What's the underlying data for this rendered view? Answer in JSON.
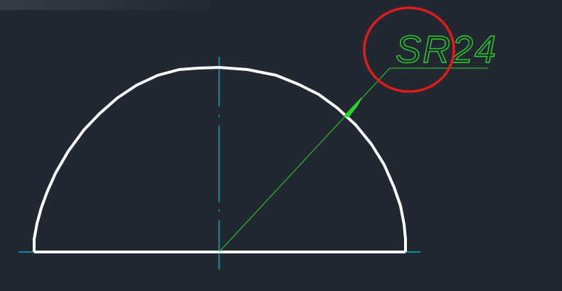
{
  "drawing": {
    "background_color": "#212831",
    "outline_color": "#ffffff",
    "centerline_color": "#00c8d2",
    "dimension_color": "#2bd42b",
    "highlight_color": "#e21b1b"
  },
  "dimension": {
    "label": "SR24",
    "type": "spherical-radius"
  }
}
